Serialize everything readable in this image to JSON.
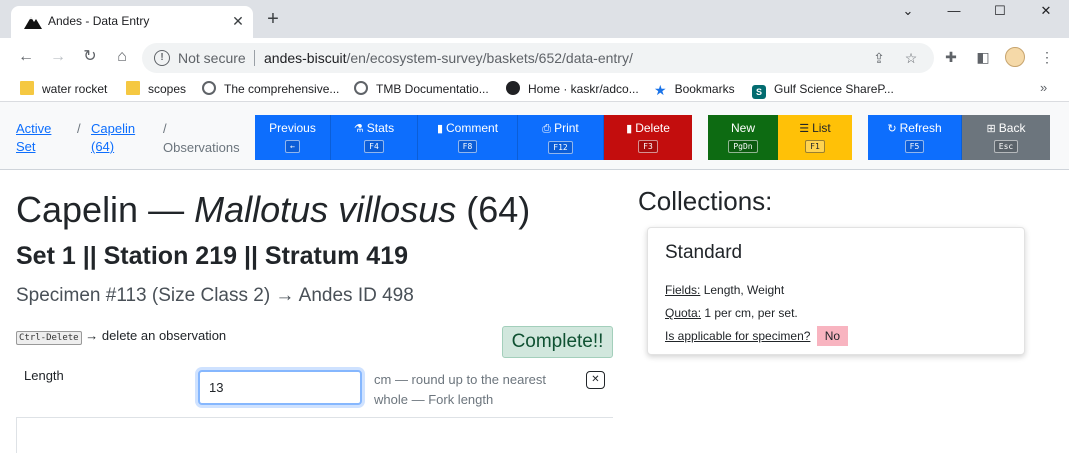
{
  "browser": {
    "tab_title": "Andes - Data Entry",
    "tab_close": "✕",
    "new_tab": "+",
    "win_minimize": "⌄",
    "win_min": "—",
    "win_max": "☐",
    "win_close": "✕",
    "not_secure": "Not secure",
    "url_host": "andes-biscuit",
    "url_path": "/en/ecosystem-survey/baskets/652/data-entry/",
    "bookmarks": [
      {
        "label": "water rocket",
        "icon": "folder-icon"
      },
      {
        "label": "scopes",
        "icon": "folder-icon"
      },
      {
        "label": "The comprehensive...",
        "icon": "globe-icon"
      },
      {
        "label": "TMB Documentatio...",
        "icon": "globe-icon"
      },
      {
        "label": "Home · kaskr/adco...",
        "icon": "github-icon"
      },
      {
        "label": "Bookmarks",
        "icon": "star-icon"
      },
      {
        "label": "Gulf Science ShareP...",
        "icon": "sharepoint-icon"
      }
    ],
    "bookmarks_more": "»"
  },
  "nav": {
    "crumb_active": "Active",
    "crumb_set": "Set",
    "crumb_species": "Capelin",
    "crumb_count": "(64)",
    "crumb_current": "Observations",
    "sep": "/",
    "buttons": {
      "previous": {
        "label": "Previous",
        "key": "←"
      },
      "stats": {
        "label": "Stats",
        "key": "F4"
      },
      "comment": {
        "label": "Comment",
        "key": "F8"
      },
      "print": {
        "label": "Print",
        "key": "F12"
      },
      "delete": {
        "label": "Delete",
        "key": "F3"
      },
      "new": {
        "label": "New",
        "key": "PgDn"
      },
      "list": {
        "label": "List",
        "key": "F1"
      },
      "refresh": {
        "label": "Refresh",
        "key": "F5"
      },
      "back": {
        "label": "Back",
        "key": "Esc"
      }
    }
  },
  "main": {
    "common_name": "Capelin",
    "dash": "—",
    "sci_name": "Mallotus villosus",
    "count": "(64)",
    "set_line": "Set 1 || Station 219 || Stratum 419",
    "specimen_line": "Specimen #113 (Size Class 2) → Andes ID 498",
    "hint_key": "Ctrl-Delete",
    "hint_text": "→ delete an observation",
    "complete": "Complete!!",
    "field": {
      "label": "Length",
      "value": "13",
      "help": "cm — round up to the nearest whole — Fork length",
      "clear": "✕"
    }
  },
  "collections": {
    "title": "Collections:",
    "card": {
      "name": "Standard",
      "fields_label": "Fields:",
      "fields_value": "Length, Weight",
      "quota_label": "Quota:",
      "quota_value": "1 per cm, per set.",
      "applicable_label": "Is applicable for specimen?",
      "applicable_value": "No"
    }
  },
  "colors": {
    "primary": "#0d6efd",
    "danger": "#c30d0d",
    "success": "#0d6b12",
    "warning": "#ffc107",
    "secondary": "#6c757d"
  }
}
